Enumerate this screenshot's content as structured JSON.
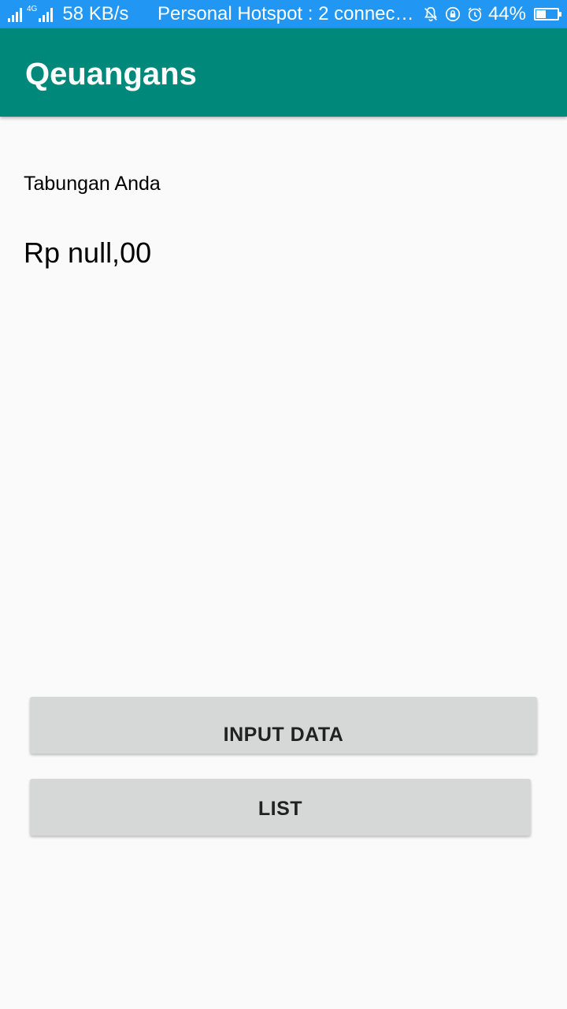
{
  "status_bar": {
    "network_type": "4G",
    "speed": "58 KB/s",
    "hotspot": "Personal Hotspot : 2 connec…",
    "battery_percent": "44%",
    "battery_level": 0.44,
    "icons": [
      "signal-icon",
      "signal-4g-icon",
      "mute-icon",
      "rotation-lock-icon",
      "alarm-icon",
      "battery-icon"
    ]
  },
  "app_bar": {
    "title": "Qeuangans",
    "color": "#00897b"
  },
  "main": {
    "savings_label": "Tabungan Anda",
    "savings_amount": "Rp null,00"
  },
  "buttons": {
    "input_data": "INPUT DATA",
    "list": "LIST"
  },
  "colors": {
    "status_bar": "#2196f3",
    "background": "#fafafa",
    "button": "#d6d7d7"
  }
}
